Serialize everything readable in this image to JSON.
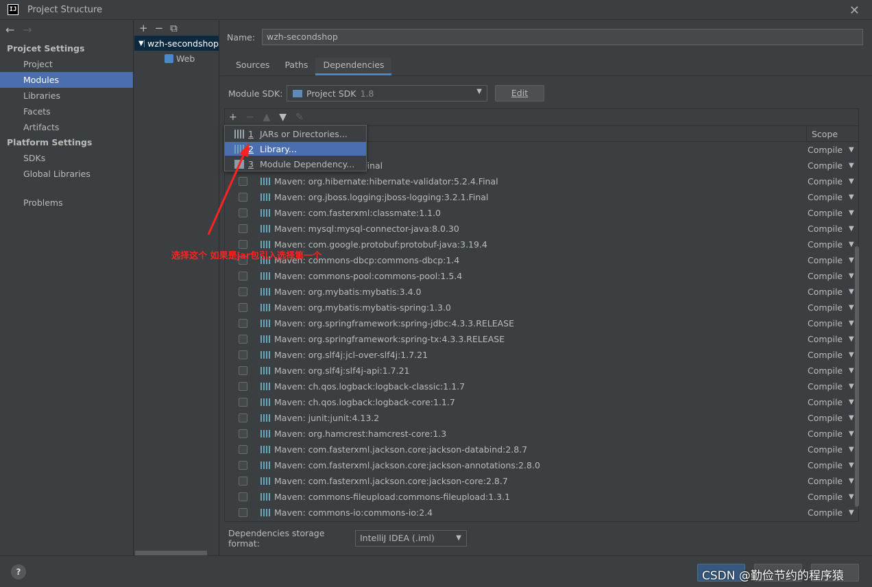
{
  "window": {
    "title": "Project Structure",
    "close_glyph": "✕"
  },
  "nav": {
    "back_glyph": "←",
    "forward_glyph": "→",
    "project_settings_header": "Projcet Settings",
    "project_items": [
      {
        "label": "Project"
      },
      {
        "label": "Modules",
        "selected": true
      },
      {
        "label": "Libraries"
      },
      {
        "label": "Facets"
      },
      {
        "label": "Artifacts"
      }
    ],
    "platform_settings_header": "Platform Settings",
    "platform_items": [
      {
        "label": "SDKs"
      },
      {
        "label": "Global Libraries"
      }
    ],
    "problems": "Problems"
  },
  "module_tree": {
    "toolbar": {
      "add": "+",
      "remove": "−",
      "copy": "⧉"
    },
    "root": "wzh-secondshop",
    "child": "Web"
  },
  "module": {
    "name_label": "Name:",
    "name_value": "wzh-secondshop",
    "tabs": [
      "Sources",
      "Paths",
      "Dependencies"
    ],
    "active_tab": "Dependencies",
    "sdk_label": "Module SDK:",
    "sdk_value": "Project SDK",
    "sdk_version": "1.8",
    "edit_label": "Edit"
  },
  "deps_toolbar": {
    "add": "+",
    "remove": "−",
    "up": "▲",
    "down": "▼",
    "edit": "✎"
  },
  "deps_table": {
    "scope_header": "Scope",
    "rows": [
      {
        "name": "",
        "scope": "Compile"
      },
      {
        "name": ":validation-api:1.1.0.Final",
        "scope": "Compile"
      },
      {
        "name": "Maven: org.hibernate:hibernate-validator:5.2.4.Final",
        "scope": "Compile"
      },
      {
        "name": "Maven: org.jboss.logging:jboss-logging:3.2.1.Final",
        "scope": "Compile"
      },
      {
        "name": "Maven: com.fasterxml:classmate:1.1.0",
        "scope": "Compile"
      },
      {
        "name": "Maven: mysql:mysql-connector-java:8.0.30",
        "scope": "Compile"
      },
      {
        "name": "Maven: com.google.protobuf:protobuf-java:3.19.4",
        "scope": "Compile"
      },
      {
        "name": "Maven: commons-dbcp:commons-dbcp:1.4",
        "scope": "Compile"
      },
      {
        "name": "Maven: commons-pool:commons-pool:1.5.4",
        "scope": "Compile"
      },
      {
        "name": "Maven: org.mybatis:mybatis:3.4.0",
        "scope": "Compile"
      },
      {
        "name": "Maven: org.mybatis:mybatis-spring:1.3.0",
        "scope": "Compile"
      },
      {
        "name": "Maven: org.springframework:spring-jdbc:4.3.3.RELEASE",
        "scope": "Compile"
      },
      {
        "name": "Maven: org.springframework:spring-tx:4.3.3.RELEASE",
        "scope": "Compile"
      },
      {
        "name": "Maven: org.slf4j:jcl-over-slf4j:1.7.21",
        "scope": "Compile"
      },
      {
        "name": "Maven: org.slf4j:slf4j-api:1.7.21",
        "scope": "Compile"
      },
      {
        "name": "Maven: ch.qos.logback:logback-classic:1.1.7",
        "scope": "Compile"
      },
      {
        "name": "Maven: ch.qos.logback:logback-core:1.1.7",
        "scope": "Compile"
      },
      {
        "name": "Maven: junit:junit:4.13.2",
        "scope": "Compile"
      },
      {
        "name": "Maven: org.hamcrest:hamcrest-core:1.3",
        "scope": "Compile"
      },
      {
        "name": "Maven: com.fasterxml.jackson.core:jackson-databind:2.8.7",
        "scope": "Compile"
      },
      {
        "name": "Maven: com.fasterxml.jackson.core:jackson-annotations:2.8.0",
        "scope": "Compile"
      },
      {
        "name": "Maven: com.fasterxml.jackson.core:jackson-core:2.8.7",
        "scope": "Compile"
      },
      {
        "name": "Maven: commons-fileupload:commons-fileupload:1.3.1",
        "scope": "Compile"
      },
      {
        "name": "Maven: commons-io:commons-io:2.4",
        "scope": "Compile"
      }
    ]
  },
  "popup": {
    "items": [
      {
        "num": "1",
        "label": "JARs or Directories...",
        "icon": "jar-icon"
      },
      {
        "num": "2",
        "label": "Library...",
        "icon": "library-icon",
        "selected": true
      },
      {
        "num": "3",
        "label": "Module Dependency...",
        "icon": "module-icon"
      }
    ]
  },
  "storage": {
    "label": "Dependencies storage format:",
    "value": "IntelliJ IDEA (.iml)"
  },
  "annotation": {
    "text": "选择这个 如果是jar包引入选择第一个",
    "color": "#ff2222"
  },
  "footer": {
    "help": "?",
    "watermark": "CSDN @勤俭节约的程序猿"
  },
  "colors": {
    "selection": "#4b6eaf",
    "background": "#3c3f41",
    "tree_selection": "#0d293e"
  }
}
